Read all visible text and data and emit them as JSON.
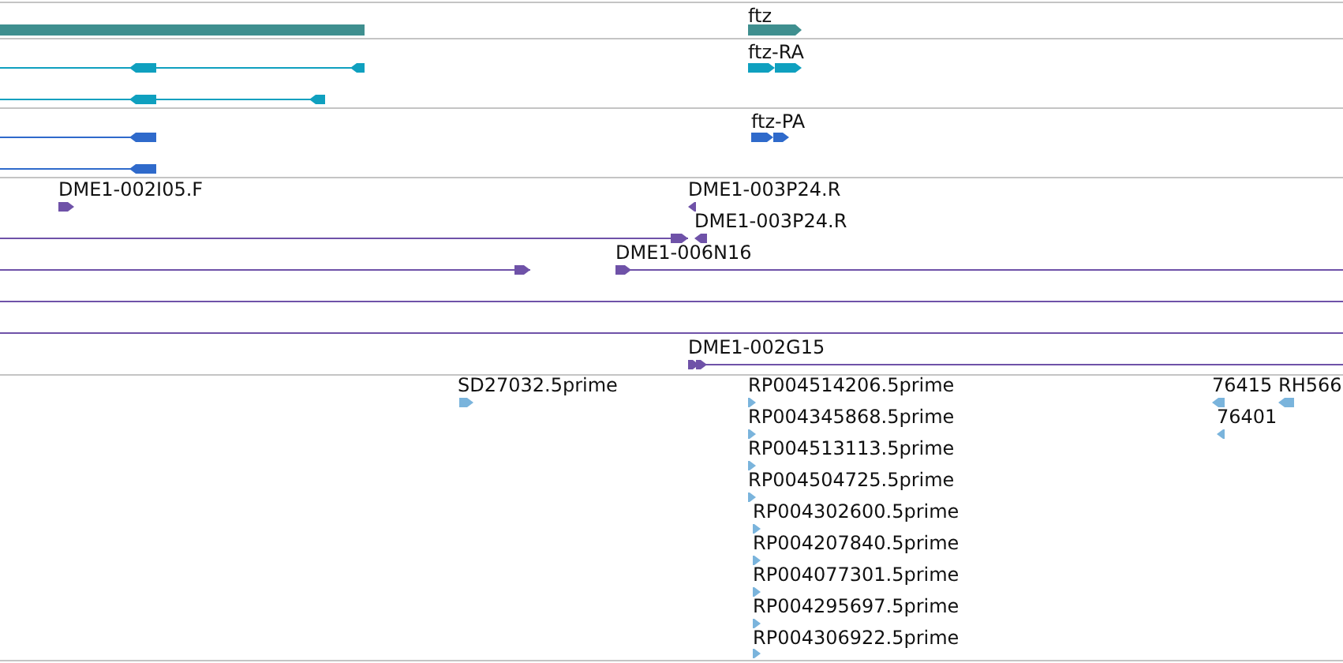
{
  "tracks": [
    {
      "kind": "gene",
      "color": "#3f8f8f",
      "features": [
        {
          "kind": "plain"
        },
        {
          "kind": "arrow",
          "label": "ftz",
          "forward": true
        }
      ]
    },
    {
      "kind": "transcript",
      "color": "#0fa0bf",
      "features": [
        {
          "kind": "arrow",
          "forward": false
        },
        {
          "kind": "arrow",
          "label": "ftz-RA",
          "forward": true
        },
        {
          "kind": "arrow",
          "forward": false
        }
      ]
    },
    {
      "kind": "protein",
      "color": "#2f6acb",
      "features": [
        {
          "kind": "arrow",
          "forward": false
        },
        {
          "kind": "arrow",
          "label": "ftz-PA",
          "forward": true
        },
        {
          "kind": "arrow",
          "forward": false
        }
      ]
    },
    {
      "kind": "clone",
      "color": "#6f52a8",
      "features": [
        {
          "kind": "arrow",
          "label": "DME1-002I05.F",
          "forward": true
        },
        {
          "kind": "arrow",
          "label": "DME1-003P24.R",
          "forward": false
        },
        {
          "kind": "arrow",
          "forward": true
        },
        {
          "kind": "arrow",
          "label": "DME1-003P24.R",
          "forward": false
        },
        {
          "kind": "arrow",
          "forward": true
        },
        {
          "kind": "arrow",
          "label": "DME1-006N16",
          "forward": true
        },
        {
          "kind": "plain"
        },
        {
          "kind": "plain"
        },
        {
          "kind": "arrow",
          "label": "DME1-002G15",
          "forward": true
        }
      ]
    },
    {
      "kind": "est",
      "color": "#7ab4dc",
      "features": [
        {
          "kind": "arrow",
          "label": "SD27032.5prime",
          "forward": true
        },
        {
          "kind": "arrow",
          "label": "RP004514206.5prime",
          "forward": true
        },
        {
          "kind": "arrow",
          "label": "RP004345868.5prime",
          "forward": true
        },
        {
          "kind": "arrow",
          "label": "RP004513113.5prime",
          "forward": true
        },
        {
          "kind": "arrow",
          "label": "RP004504725.5prime",
          "forward": true
        },
        {
          "kind": "arrow",
          "label": "RP004302600.5prime",
          "forward": true
        },
        {
          "kind": "arrow",
          "label": "RP004207840.5prime",
          "forward": true
        },
        {
          "kind": "arrow",
          "label": "RP004077301.5prime",
          "forward": true
        },
        {
          "kind": "arrow",
          "label": "RP004295697.5prime",
          "forward": true
        },
        {
          "kind": "arrow",
          "label": "RP004306922.5prime",
          "forward": true
        },
        {
          "kind": "arrow",
          "label": "76415",
          "forward": false
        },
        {
          "kind": "arrow",
          "label": "RH566",
          "forward": false
        },
        {
          "kind": "arrow",
          "label": "76401",
          "forward": false
        }
      ]
    }
  ]
}
